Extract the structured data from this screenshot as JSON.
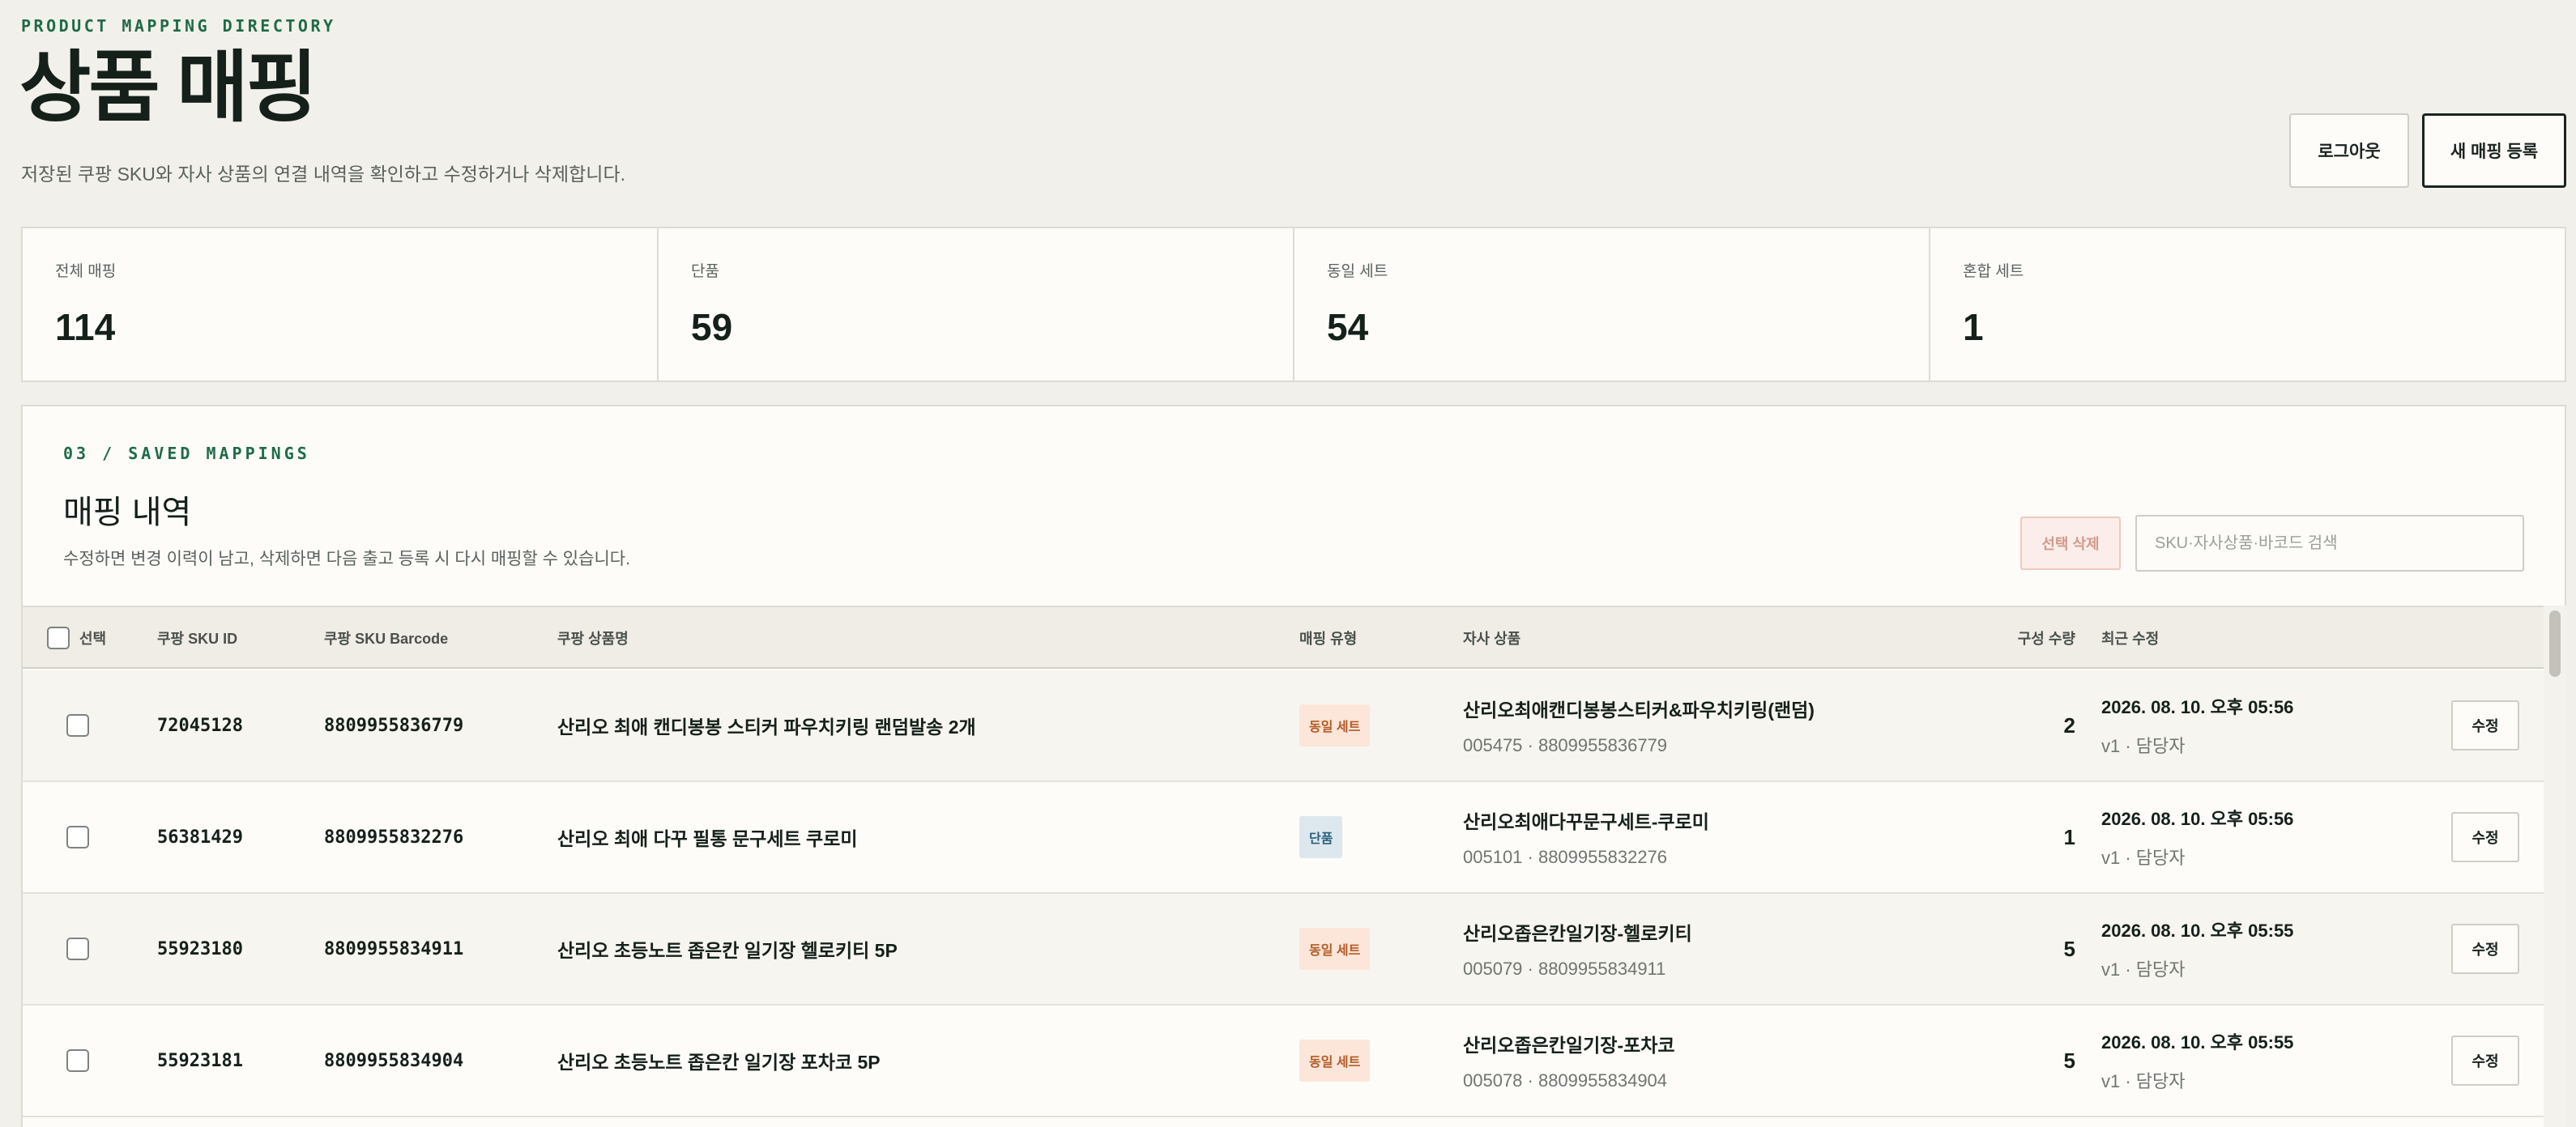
{
  "header": {
    "eyebrow": "PRODUCT MAPPING DIRECTORY",
    "title": "상품 매핑",
    "subtitle": "저장된 쿠팡 SKU와 자사 상품의 연결 내역을 확인하고 수정하거나 삭제합니다.",
    "logout_label": "로그아웃",
    "new_mapping_label": "새 매핑 등록"
  },
  "stats": [
    {
      "label": "전체 매핑",
      "value": "114"
    },
    {
      "label": "단품",
      "value": "59"
    },
    {
      "label": "동일 세트",
      "value": "54"
    },
    {
      "label": "혼합 세트",
      "value": "1"
    }
  ],
  "panel": {
    "eyebrow": "03 / SAVED MAPPINGS",
    "title": "매핑 내역",
    "description": "수정하면 변경 이력이 남고, 삭제하면 다음 출고 등록 시 다시 매핑할 수 있습니다.",
    "bulk_delete_label": "선택 삭제",
    "search_placeholder": "SKU·자사상품·바코드 검색"
  },
  "table": {
    "columns": {
      "select": "선택",
      "sku_id": "쿠팡 SKU ID",
      "sku_barcode": "쿠팡 SKU Barcode",
      "product_name": "쿠팡 상품명",
      "mapping_type": "매핑 유형",
      "own_product": "자사 상품",
      "quantity": "구성 수량",
      "updated": "최근 수정"
    },
    "edit_label": "수정",
    "rows": [
      {
        "sku_id": "72045128",
        "barcode": "8809955836779",
        "name": "산리오 최애 캔디봉봉 스티커 파우치키링 랜덤발송 2개",
        "type": "동일 세트",
        "own_name": "산리오최애캔디봉봉스티커&파우치키링(랜덤)",
        "own_code": "005475 · 8809955836779",
        "qty": "2",
        "date": "2026. 08. 10. 오후 05:56",
        "by": "v1 · 담당자"
      },
      {
        "sku_id": "56381429",
        "barcode": "8809955832276",
        "name": "산리오 최애 다꾸 필통 문구세트 쿠로미",
        "type": "단품",
        "own_name": "산리오최애다꾸문구세트-쿠로미",
        "own_code": "005101 · 8809955832276",
        "qty": "1",
        "date": "2026. 08. 10. 오후 05:56",
        "by": "v1 · 담당자"
      },
      {
        "sku_id": "55923180",
        "barcode": "8809955834911",
        "name": "산리오 초등노트 좁은칸 일기장 헬로키티 5P",
        "type": "동일 세트",
        "own_name": "산리오좁은칸일기장-헬로키티",
        "own_code": "005079 · 8809955834911",
        "qty": "5",
        "date": "2026. 08. 10. 오후 05:55",
        "by": "v1 · 담당자"
      },
      {
        "sku_id": "55923181",
        "barcode": "8809955834904",
        "name": "산리오 초등노트 좁은칸 일기장 포차코 5P",
        "type": "동일 세트",
        "own_name": "산리오좁은칸일기장-포차코",
        "own_code": "005078 · 8809955834904",
        "qty": "5",
        "date": "2026. 08. 10. 오후 05:55",
        "by": "v1 · 담당자"
      }
    ]
  },
  "colors": {
    "accent_green": "#1f6b47",
    "background": "#f2f0ea",
    "badge_set_bg": "#fbe6d9",
    "badge_set_text": "#b45a25",
    "badge_single_bg": "#dde8ee",
    "badge_single_text": "#2b5f7d"
  }
}
